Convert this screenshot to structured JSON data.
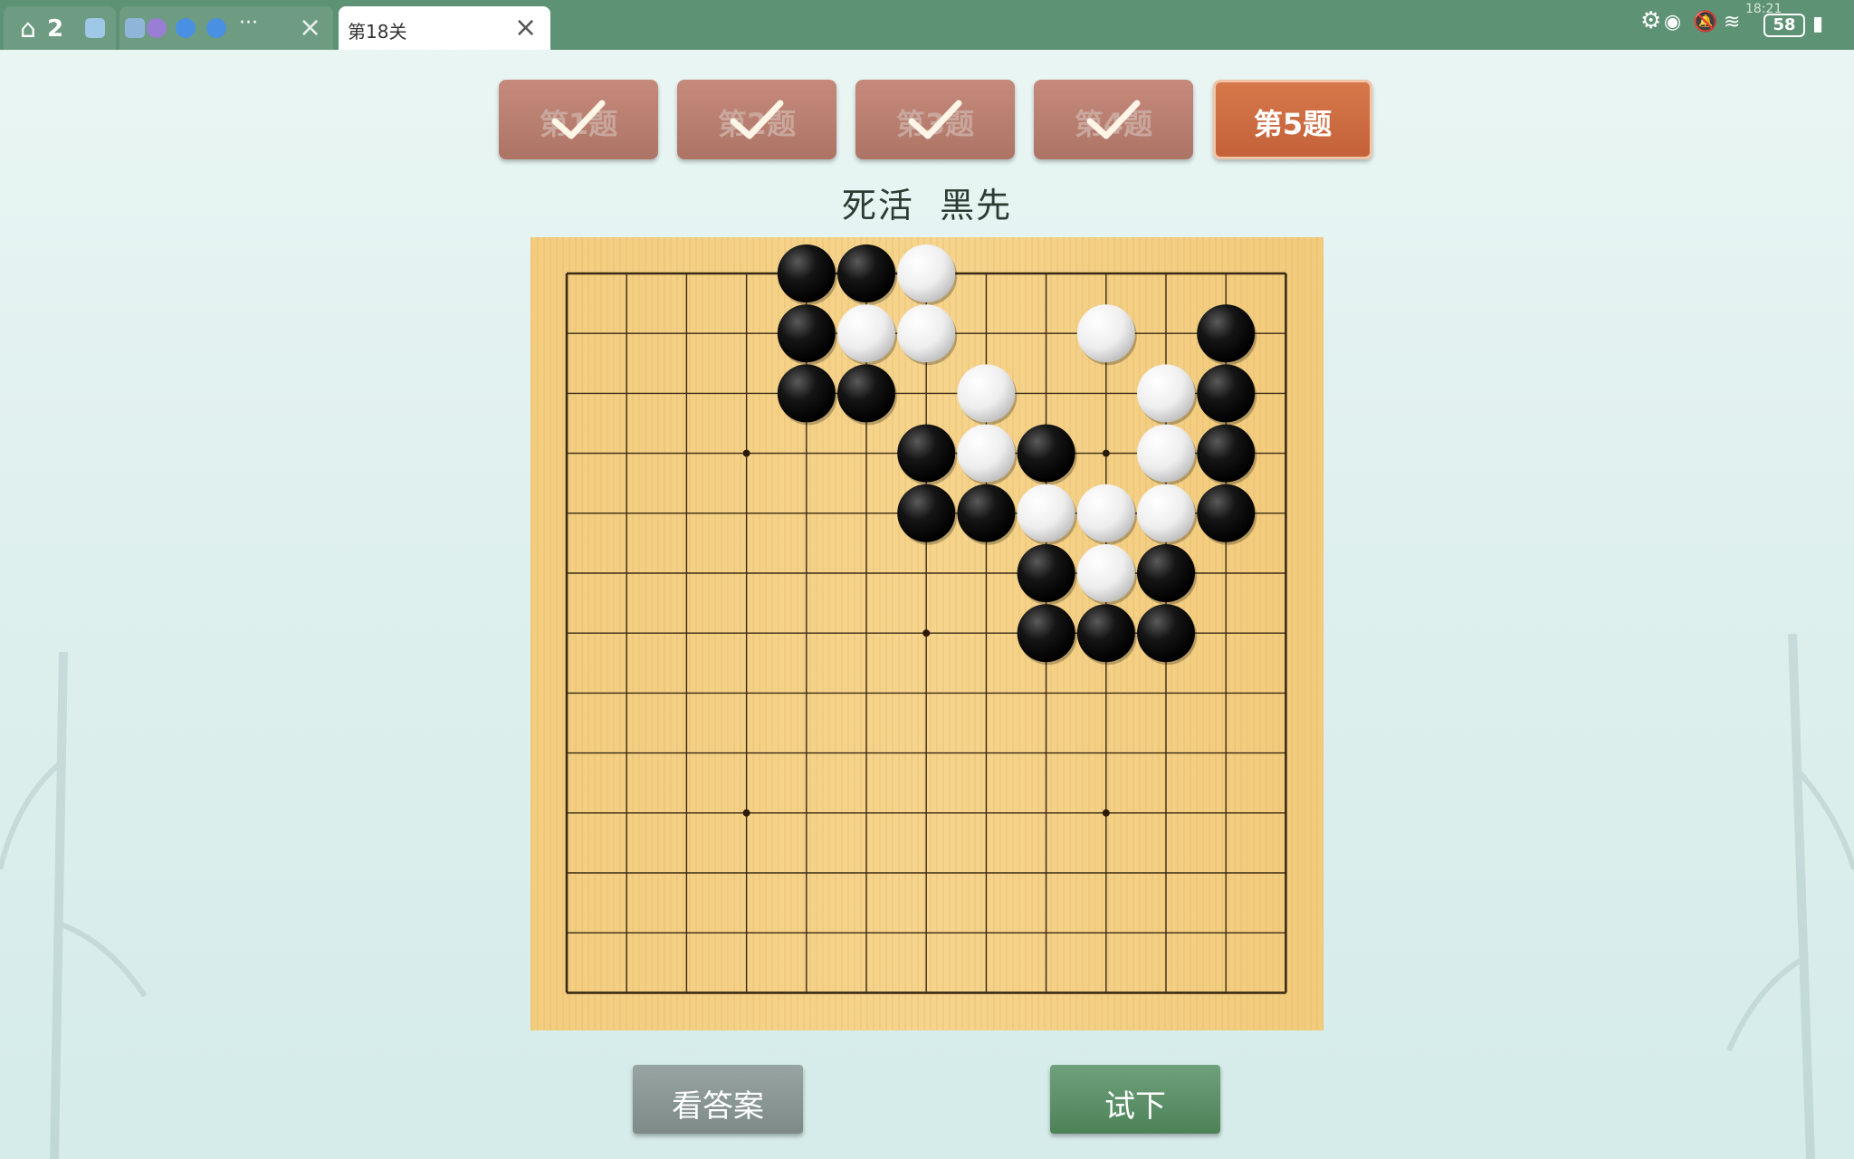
{
  "tabs": {
    "home_count": "2",
    "active_title": "第18关"
  },
  "status": {
    "battery": "58",
    "clock": "18:21"
  },
  "problems": [
    {
      "label": "第1题",
      "state": "done"
    },
    {
      "label": "第2题",
      "state": "done"
    },
    {
      "label": "第3题",
      "state": "done"
    },
    {
      "label": "第4题",
      "state": "done"
    },
    {
      "label": "第5题",
      "state": "current"
    }
  ],
  "subtitle": "死活  黑先",
  "board": {
    "size": 13,
    "stars": [
      [
        3,
        3
      ],
      [
        9,
        3
      ],
      [
        6,
        6
      ],
      [
        3,
        9
      ],
      [
        9,
        9
      ]
    ],
    "black": [
      [
        4,
        0
      ],
      [
        5,
        0
      ],
      [
        4,
        1
      ],
      [
        4,
        2
      ],
      [
        5,
        2
      ],
      [
        6,
        3
      ],
      [
        8,
        3
      ],
      [
        6,
        4
      ],
      [
        7,
        4
      ],
      [
        8,
        5
      ],
      [
        10,
        5
      ],
      [
        8,
        6
      ],
      [
        9,
        6
      ],
      [
        10,
        6
      ],
      [
        11,
        1
      ],
      [
        11,
        2
      ],
      [
        11,
        3
      ],
      [
        11,
        4
      ]
    ],
    "white": [
      [
        6,
        0
      ],
      [
        5,
        1
      ],
      [
        6,
        1
      ],
      [
        9,
        1
      ],
      [
        7,
        2
      ],
      [
        10,
        2
      ],
      [
        7,
        3
      ],
      [
        10,
        3
      ],
      [
        8,
        4
      ],
      [
        9,
        4
      ],
      [
        10,
        4
      ],
      [
        9,
        5
      ]
    ]
  },
  "buttons": {
    "answer": "看答案",
    "try": "试下"
  },
  "colors": {
    "topbar": "#5e9274",
    "board": "#f4cf84",
    "current_problem": "#cf6e44",
    "done_problem": "#b87d6f"
  }
}
